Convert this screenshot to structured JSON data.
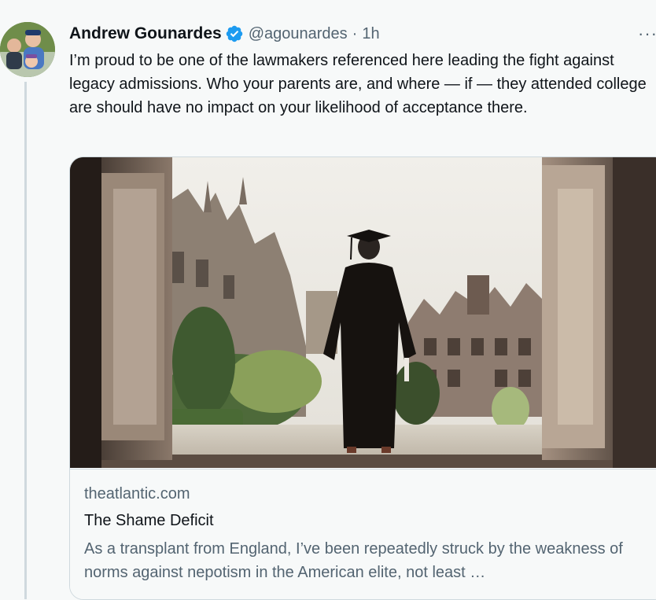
{
  "author": {
    "name": "Andrew Gounardes",
    "handle": "@agounardes",
    "separator": "·",
    "time": "1h",
    "verified": true,
    "verified_color": "#1d9bf0"
  },
  "tweet": {
    "text": "I’m proud to be one of the lawmakers referenced here leading the fight against legacy admissions. Who your parents are, and where — if — they attended college are should have no impact on your likelihood of acceptance there."
  },
  "more_icon": "more-dots-icon",
  "link_card": {
    "domain": "theatlantic.com",
    "title": "The Shame Deficit",
    "description": "As a transplant from England, I’ve been repeatedly struck by the weakness of norms against nepotism in the American elite, not least …",
    "image": "graduate-in-gown-standing-in-university-courtyard"
  },
  "colors": {
    "background": "#f7f9f9",
    "text_primary": "#0f1419",
    "text_secondary": "#536471",
    "border": "#cfd9de"
  }
}
